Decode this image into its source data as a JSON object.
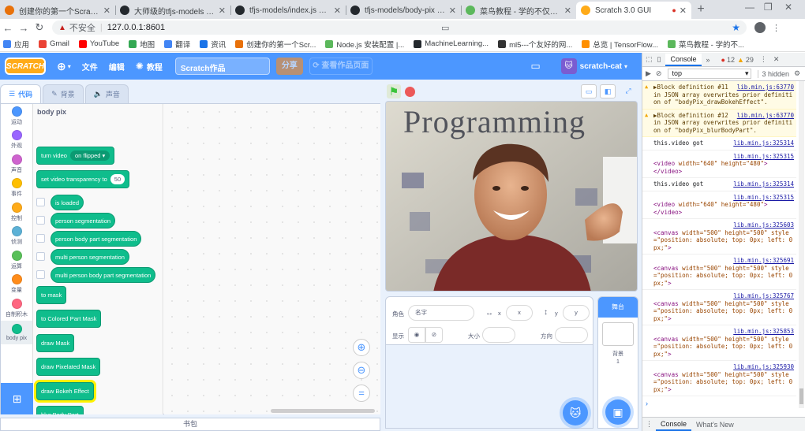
{
  "browser": {
    "tabs": [
      {
        "title": "创建你的第一个Scratch3.0 E",
        "icon": "scratch-icon",
        "color": "#e8710a"
      },
      {
        "title": "大师级的tfjs-models / body",
        "icon": "github-icon",
        "color": "#24292e"
      },
      {
        "title": "tfjs-models/index.js at ma",
        "icon": "github-icon",
        "color": "#24292e"
      },
      {
        "title": "tfjs-models/body-pix at m",
        "icon": "github-icon",
        "color": "#24292e"
      },
      {
        "title": "菜鸟教程 - 学的不仅是技术",
        "icon": "runoob-icon",
        "color": "#5cb85c"
      },
      {
        "title": "Scratch 3.0 GUI",
        "icon": "scratch-icon",
        "color": "#ffab19",
        "active": true
      }
    ],
    "url_warning": "不安全",
    "url": "127.0.0.1:8601",
    "bookmarks": [
      {
        "label": "应用",
        "color": "#4285f4"
      },
      {
        "label": "Gmail",
        "color": "#ea4335"
      },
      {
        "label": "YouTube",
        "color": "#ff0000"
      },
      {
        "label": "地图",
        "color": "#34a853"
      },
      {
        "label": "翻译",
        "color": "#4285f4"
      },
      {
        "label": "资讯",
        "color": "#1a73e8"
      },
      {
        "label": "创建你的第一个Scr...",
        "color": "#e8710a"
      },
      {
        "label": "Node.js 安装配置 |...",
        "color": "#5cb85c"
      },
      {
        "label": "MachineLearning...",
        "color": "#24292e"
      },
      {
        "label": "ml5---个友好的网...",
        "color": "#333333"
      },
      {
        "label": "总览 | TensorFlow...",
        "color": "#ff8f00"
      },
      {
        "label": "菜鸟教程 - 学的不...",
        "color": "#5cb85c"
      }
    ]
  },
  "scratch": {
    "logo": "SCRATCH",
    "menu": {
      "file": "文件",
      "edit": "编辑",
      "tutorial": "教程",
      "project_title": "Scratch作品",
      "share": "分享",
      "see_project": "查看作品页面",
      "username": "scratch-cat"
    },
    "tabs": {
      "code": "代码",
      "costumes": "背景",
      "sounds": "声音"
    },
    "categories": [
      {
        "label": "运动",
        "color": "#4c97ff"
      },
      {
        "label": "外观",
        "color": "#9966ff"
      },
      {
        "label": "声音",
        "color": "#cf63cf"
      },
      {
        "label": "事件",
        "color": "#ffbf00"
      },
      {
        "label": "控制",
        "color": "#ffab19"
      },
      {
        "label": "侦测",
        "color": "#5cb1d6"
      },
      {
        "label": "运算",
        "color": "#59c059"
      },
      {
        "label": "变量",
        "color": "#ff8c1a"
      },
      {
        "label": "自制积木",
        "color": "#ff6680"
      },
      {
        "label": "body pix",
        "color": "#0fbd8c",
        "selected": true
      }
    ],
    "flyout": {
      "title": "body pix",
      "blocks": [
        {
          "text": "turn video",
          "menu": "on flipped ▾",
          "kind": "cmd"
        },
        {
          "text": "set video transparency to",
          "num": "50",
          "kind": "cmd"
        },
        {
          "text": "is loaded",
          "kind": "rep"
        },
        {
          "text": "person segmentation",
          "kind": "rep"
        },
        {
          "text": "person body part segmentation",
          "kind": "rep"
        },
        {
          "text": "multi person segmentation",
          "kind": "rep"
        },
        {
          "text": "multi person body part segmentation",
          "kind": "rep"
        },
        {
          "text": "to mask",
          "kind": "cmd"
        },
        {
          "text": "to Colored Part Mask",
          "kind": "cmd"
        },
        {
          "text": "draw Mask",
          "kind": "cmd"
        },
        {
          "text": "draw Pixelated Mask",
          "kind": "cmd"
        },
        {
          "text": "draw Bokeh Effect",
          "kind": "cmd",
          "highlighted": true
        },
        {
          "text": "blur Body Part",
          "kind": "cmd"
        }
      ]
    },
    "backpack": "书包",
    "stage_text": "Programming",
    "sprite_info": {
      "sprite_label": "角色",
      "name_placeholder": "名字",
      "x_label": "x",
      "x_value": "x",
      "y_label": "y",
      "y_value": "y",
      "show_label": "显示",
      "size_label": "大小",
      "direction_label": "方向"
    },
    "stage_pane": {
      "title": "舞台",
      "backdrop_label": "背景",
      "backdrop_count": "1"
    }
  },
  "devtools": {
    "tab_console": "Console",
    "errors": "12",
    "warnings": "29",
    "context": "top",
    "hidden": "3 hidden",
    "drawer_console": "Console",
    "drawer_whatsnew": "What's New",
    "messages": [
      {
        "type": "warn",
        "text": "▶Block definition #11 in JSON array overwrites prior definition of \"bodyPix_drawBokehEffect\".",
        "source": "lib.min.js:63770"
      },
      {
        "type": "warn",
        "text": "▶Block definition #12 in JSON array overwrites prior definition of \"bodyPix_blurBodyPart\".",
        "source": "lib.min.js:63770"
      },
      {
        "type": "log",
        "text": "this.video got",
        "source": "lib.min.js:325314"
      },
      {
        "type": "elem",
        "tag": "video",
        "attrs": "width=\"640\" height=\"480\"",
        "close": "</video>",
        "source": "lib.min.js:325315"
      },
      {
        "type": "log",
        "text": "this.video got",
        "source": "lib.min.js:325314"
      },
      {
        "type": "elem",
        "tag": "video",
        "attrs": "width=\"640\" height=\"480\"",
        "close": "</video>",
        "source": "lib.min.js:325315"
      },
      {
        "type": "elem",
        "tag": "canvas",
        "attrs": "width=\"500\" height=\"500\" style=\"position: absolute; top: 0px; left: 0px;\"",
        "source": "lib.min.js:325603"
      },
      {
        "type": "elem",
        "tag": "canvas",
        "attrs": "width=\"500\" height=\"500\" style=\"position: absolute; top: 0px; left: 0px;\"",
        "source": "lib.min.js:325691"
      },
      {
        "type": "elem",
        "tag": "canvas",
        "attrs": "width=\"500\" height=\"500\" style=\"position: absolute; top: 0px; left: 0px;\"",
        "source": "lib.min.js:325767"
      },
      {
        "type": "elem",
        "tag": "canvas",
        "attrs": "width=\"500\" height=\"500\" style=\"position: absolute; top: 0px; left: 0px;\"",
        "source": "lib.min.js:325853"
      },
      {
        "type": "elem",
        "tag": "canvas",
        "attrs": "width=\"500\" height=\"500\" style=\"position: absolute; top: 0px; left: 0px;\"",
        "source": "lib.min.js:325930"
      }
    ]
  }
}
